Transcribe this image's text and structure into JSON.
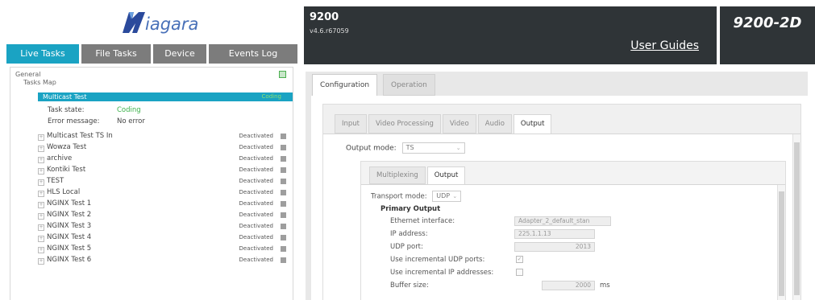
{
  "logo": {
    "text": "iagara"
  },
  "nav_tabs": [
    {
      "label": "Live Tasks"
    },
    {
      "label": "File Tasks"
    },
    {
      "label": "Device"
    },
    {
      "label": "Events Log"
    }
  ],
  "tree": {
    "root": "General",
    "map": "Tasks Map",
    "selected": {
      "label": "Multicast Test",
      "status": "Coding"
    },
    "task_state_label": "Task state:",
    "task_state_value": "Coding",
    "error_label": "Error message:",
    "error_value": "No error",
    "tasks": [
      {
        "label": "Multicast Test TS In",
        "status": "Deactivated"
      },
      {
        "label": "Wowza Test",
        "status": "Deactivated"
      },
      {
        "label": "archive",
        "status": "Deactivated"
      },
      {
        "label": "Kontiki Test",
        "status": "Deactivated"
      },
      {
        "label": "TEST",
        "status": "Deactivated"
      },
      {
        "label": "HLS Local",
        "status": "Deactivated"
      },
      {
        "label": "NGINX Test 1",
        "status": "Deactivated"
      },
      {
        "label": "NGINX Test 2",
        "status": "Deactivated"
      },
      {
        "label": "NGINX Test 3",
        "status": "Deactivated"
      },
      {
        "label": "NGINX Test 4",
        "status": "Deactivated"
      },
      {
        "label": "NGINX Test 5",
        "status": "Deactivated"
      },
      {
        "label": "NGINX Test 6",
        "status": "Deactivated"
      }
    ]
  },
  "header": {
    "title": "9200",
    "version": "v4.6.r67059",
    "guides": "User Guides",
    "model": "9200-2D"
  },
  "config": {
    "tabs": [
      {
        "label": "Configuration"
      },
      {
        "label": "Operation"
      }
    ],
    "inner_tabs": [
      {
        "label": "Input"
      },
      {
        "label": "Video Processing"
      },
      {
        "label": "Video"
      },
      {
        "label": "Audio"
      },
      {
        "label": "Output"
      }
    ],
    "output_mode_label": "Output mode:",
    "output_mode_value": "TS",
    "mux_tabs": [
      {
        "label": "Multiplexing"
      },
      {
        "label": "Output"
      }
    ],
    "transport_label": "Transport mode:",
    "transport_value": "UDP",
    "primary_heading": "Primary Output",
    "eth_label": "Ethernet interface:",
    "eth_value": "Adapter_2_default_stan",
    "ip_label": "IP address:",
    "ip_value": "225.1.1.13",
    "port_label": "UDP port:",
    "port_value": "2013",
    "incr_udp_label": "Use incremental UDP ports:",
    "incr_udp_checked": true,
    "incr_ip_label": "Use incremental IP addresses:",
    "incr_ip_checked": false,
    "buffer_label": "Buffer size:",
    "buffer_value": "2000",
    "buffer_unit": "ms"
  },
  "colors": {
    "accent": "#1aa3c3",
    "header_bg": "#2f3437",
    "coding_green": "#3bb24a",
    "tab_inactive": "#7c7c7c"
  }
}
